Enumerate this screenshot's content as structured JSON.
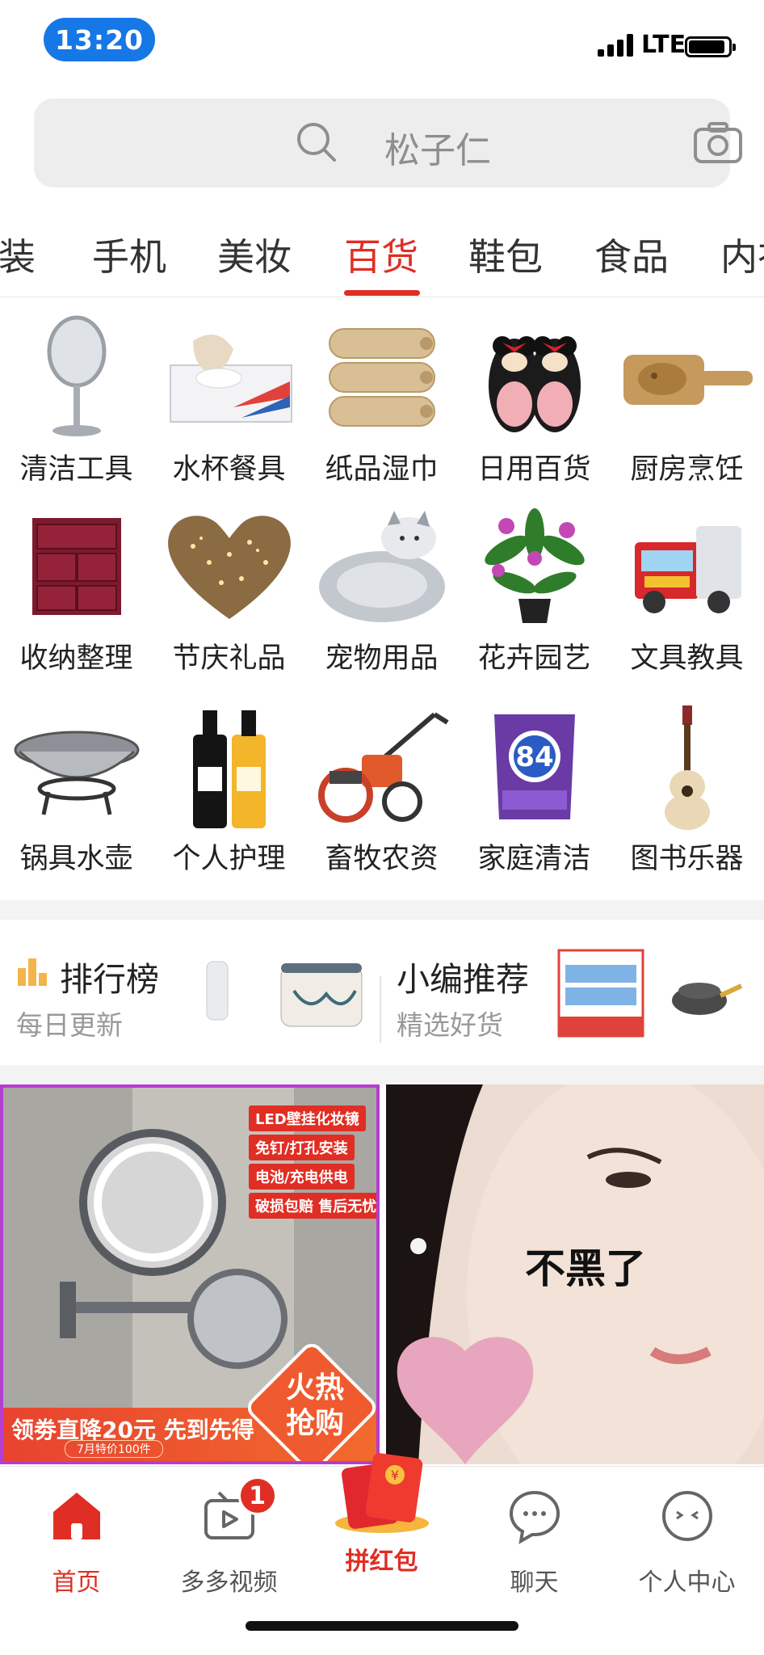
{
  "status_bar": {
    "time": "13:20",
    "network": "LTE"
  },
  "search": {
    "placeholder": "松子仁"
  },
  "tabs": [
    {
      "label": "女装"
    },
    {
      "label": "手机"
    },
    {
      "label": "美妆"
    },
    {
      "label": "百货",
      "active": true
    },
    {
      "label": "鞋包"
    },
    {
      "label": "食品"
    },
    {
      "label": "内衣"
    }
  ],
  "categories": [
    {
      "label": "清洁工具",
      "icon": "vanity-mirror-icon"
    },
    {
      "label": "水杯餐具",
      "icon": "tissue-box-icon"
    },
    {
      "label": "纸品湿巾",
      "icon": "paper-rolls-icon"
    },
    {
      "label": "日用百货",
      "icon": "slippers-icon"
    },
    {
      "label": "厨房烹饪",
      "icon": "mold-icon"
    },
    {
      "label": "收纳整理",
      "icon": "drawer-box-icon"
    },
    {
      "label": "节庆礼品",
      "icon": "heart-lights-icon"
    },
    {
      "label": "宠物用品",
      "icon": "pet-bed-icon"
    },
    {
      "label": "花卉园艺",
      "icon": "flower-pot-icon"
    },
    {
      "label": "文具教具",
      "icon": "toy-truck-icon"
    },
    {
      "label": "锅具水壶",
      "icon": "wok-icon"
    },
    {
      "label": "个人护理",
      "icon": "shampoo-bottles-icon"
    },
    {
      "label": "畜牧农资",
      "icon": "tiller-icon"
    },
    {
      "label": "家庭清洁",
      "icon": "detergent-bag-icon"
    },
    {
      "label": "图书乐器",
      "icon": "ukulele-icon"
    }
  ],
  "ranking": {
    "title": "排行榜",
    "subtitle": "每日更新"
  },
  "recommend": {
    "title": "小编推荐",
    "subtitle": "精选好货"
  },
  "products": [
    {
      "tags": [
        "LED壁挂化妆镜",
        "免钉/打孔安装",
        "电池/充电供电",
        "破损包赔 售后无忧"
      ],
      "promo": "领劵直降20元 先到先得",
      "promo_sub": "7月特价100件",
      "hot_badge": "火热抢购"
    },
    {
      "caption": "不黑了"
    }
  ],
  "bottom_nav": [
    {
      "label": "首页",
      "icon": "home-icon",
      "active": true
    },
    {
      "label": "多多视频",
      "icon": "video-icon",
      "badge": "1"
    },
    {
      "label": "拼红包",
      "icon": "red-envelope-icon"
    },
    {
      "label": "聊天",
      "icon": "chat-icon"
    },
    {
      "label": "个人中心",
      "icon": "profile-icon"
    }
  ],
  "colors": {
    "accent": "#e02e24",
    "time_pill": "#1677e6"
  }
}
